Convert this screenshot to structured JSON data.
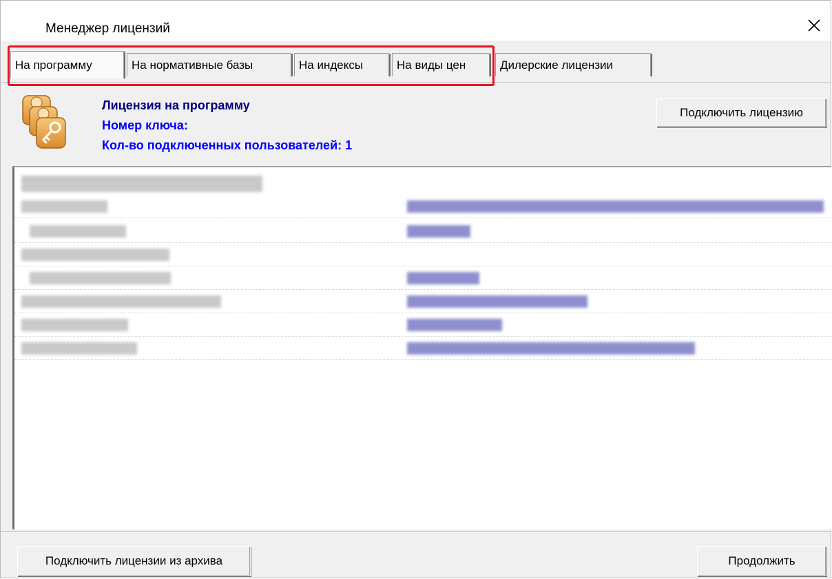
{
  "window": {
    "title": "Менеджер лицензий",
    "close_icon": "close-icon"
  },
  "tabs": [
    {
      "label": "На программу",
      "active": true
    },
    {
      "label": "На нормативные базы",
      "active": false
    },
    {
      "label": "На индексы",
      "active": false
    },
    {
      "label": "На виды цен",
      "active": false
    },
    {
      "label": "Дилерские лицензии",
      "active": false
    }
  ],
  "highlight_color": "#e81123",
  "license_info": {
    "icon": "license-key-icon",
    "title": "Лицензия на программу",
    "key_number": "Номер ключа:",
    "users_count": "Кол-во подключенных пользователей: 1",
    "title_color": "#000080",
    "text_color": "#0000ff"
  },
  "connect_button": "Подключить лицензию",
  "footer": {
    "archive_button": "Подключить лицензии из архива",
    "continue_button": "Продолжить"
  }
}
